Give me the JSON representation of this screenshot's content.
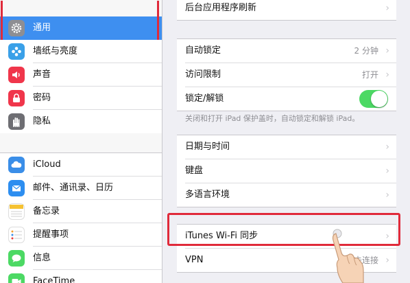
{
  "sidebar": {
    "items": [
      {
        "label": "通用",
        "icon": "gear-icon"
      },
      {
        "label": "墙纸与亮度",
        "icon": "flower-icon"
      },
      {
        "label": "声音",
        "icon": "speaker-icon"
      },
      {
        "label": "密码",
        "icon": "lock-icon"
      },
      {
        "label": "隐私",
        "icon": "hand-icon"
      },
      {
        "label": "iCloud",
        "icon": "cloud-icon"
      },
      {
        "label": "邮件、通讯录、日历",
        "icon": "mail-icon"
      },
      {
        "label": "备忘录",
        "icon": "notes-icon"
      },
      {
        "label": "提醒事项",
        "icon": "reminders-icon"
      },
      {
        "label": "信息",
        "icon": "messages-icon"
      },
      {
        "label": "FaceTime",
        "icon": "facetime-icon"
      }
    ],
    "selected": "通用"
  },
  "main": {
    "background_refresh": {
      "label": "后台应用程序刷新"
    },
    "auto_lock": {
      "label": "自动锁定",
      "value": "2 分钟"
    },
    "restrictions": {
      "label": "访问限制",
      "value": "打开"
    },
    "lock_unlock": {
      "label": "锁定/解锁",
      "on": true
    },
    "lock_note": "关闭和打开 iPad 保护盖时，自动锁定和解锁 iPad。",
    "date_time": {
      "label": "日期与时间"
    },
    "keyboard": {
      "label": "键盘"
    },
    "language": {
      "label": "多语言环境"
    },
    "itunes_sync": {
      "label": "iTunes Wi-Fi 同步"
    },
    "vpn": {
      "label": "VPN",
      "value": "未连接"
    }
  },
  "colors": {
    "selected_row": "#3e8ff0",
    "highlight_frame": "#e02a3a",
    "toggle_on": "#4cd964"
  }
}
